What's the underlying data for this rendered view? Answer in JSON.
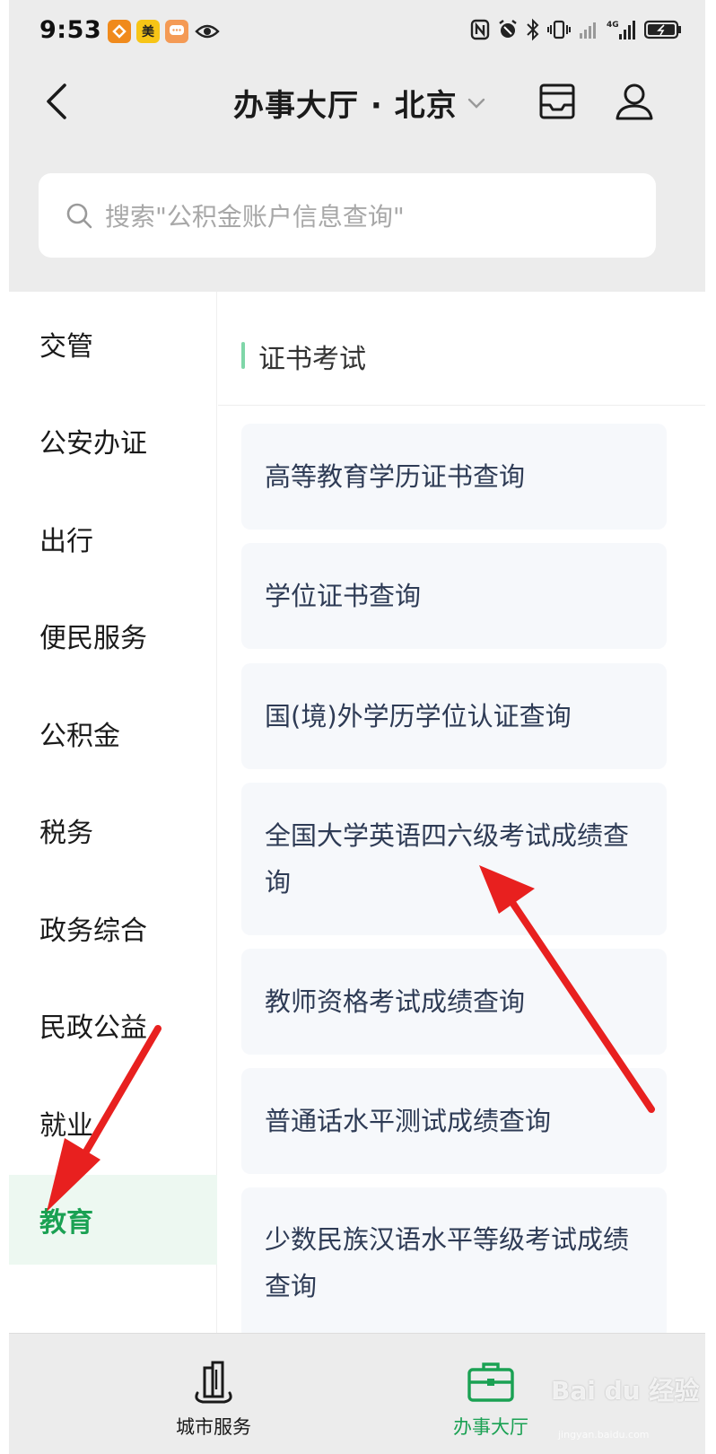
{
  "status_bar": {
    "time": "9:53",
    "notifications": [
      {
        "icon": "app-notification-icon",
        "label": ""
      },
      {
        "icon": "meituan-icon",
        "label": "美"
      },
      {
        "icon": "message-icon",
        "label": ""
      },
      {
        "icon": "eye-icon",
        "label": ""
      }
    ],
    "system_icons": [
      "nfc-icon",
      "alarm-icon",
      "bluetooth-icon",
      "vibrate-icon",
      "wifi-icon",
      "signal-icon",
      "battery-icon"
    ],
    "network_label": "4G"
  },
  "nav": {
    "title": "办事大厅 · 北京",
    "back_icon": "chevron-left-icon",
    "dropdown_icon": "chevron-down-icon",
    "inbox_icon": "inbox-icon",
    "user_icon": "user-icon"
  },
  "search": {
    "placeholder": "搜索\"公积金账户信息查询\""
  },
  "sidebar": {
    "active_index": 9,
    "items": [
      {
        "label": "交管"
      },
      {
        "label": "公安办证"
      },
      {
        "label": "出行"
      },
      {
        "label": "便民服务"
      },
      {
        "label": "公积金"
      },
      {
        "label": "税务"
      },
      {
        "label": "政务综合"
      },
      {
        "label": "民政公益"
      },
      {
        "label": "就业"
      },
      {
        "label": "教育"
      }
    ]
  },
  "content": {
    "section_title": "证书考试",
    "services": [
      {
        "label": "高等教育学历证书查询"
      },
      {
        "label": "学位证书查询"
      },
      {
        "label": "国(境)外学历学位认证查询"
      },
      {
        "label": "全国大学英语四六级考试成绩查询"
      },
      {
        "label": "教师资格考试成绩查询"
      },
      {
        "label": "普通话水平测试成绩查询"
      },
      {
        "label": "少数民族汉语水平等级考试成绩查询"
      }
    ]
  },
  "tabbar": {
    "active_index": 1,
    "tabs": [
      {
        "label": "城市服务",
        "icon": "city-building-icon"
      },
      {
        "label": "办事大厅",
        "icon": "briefcase-icon"
      }
    ]
  },
  "watermark": {
    "text": "Bai du 经验",
    "sub": "jingyan.baidu.com"
  },
  "colors": {
    "accent": "#1aa153",
    "arrow": "#e8201f",
    "header_bg": "#ececec",
    "card_bg": "#f6f8fb",
    "active_bg": "#edf8f1"
  }
}
